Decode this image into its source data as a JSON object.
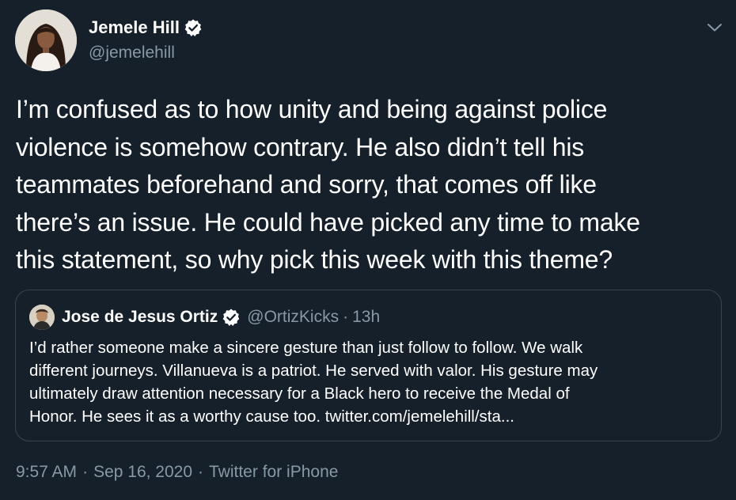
{
  "tweet": {
    "author": {
      "name": "Jemele Hill",
      "handle": "@jemelehill",
      "verified": true
    },
    "text_lines": [
      "I’m confused as to how unity and being against police",
      "violence is somehow contrary. He also didn’t tell his",
      "teammates beforehand and sorry, that comes off like",
      "there’s an issue. He could have picked any time to make",
      "this statement, so why pick this week with this theme?"
    ],
    "quoted": {
      "name": "Jose de Jesus Ortiz",
      "handle": "@OrtizKicks",
      "separator": "·",
      "time": "13h",
      "verified": true,
      "text_lines": [
        "I’d rather someone make a sincere gesture than just follow to follow. We walk",
        "different journeys. Villanueva is a patriot. He served with valor. His gesture may",
        "ultimately draw attention necessary for a Black hero to receive the Medal of",
        "Honor. He sees it as a worthy cause too. twitter.com/jemelehill/sta..."
      ]
    },
    "meta": {
      "time": "9:57 AM",
      "sep1": "·",
      "date": "Sep 16, 2020",
      "sep2": "·",
      "source": "Twitter for iPhone"
    }
  },
  "icons": {
    "verified": "verified-badge-icon",
    "caret": "chevron-down-icon"
  },
  "colors": {
    "background": "#15202b",
    "text_primary": "#ffffff",
    "text_secondary": "#8899a6",
    "border": "#38444d"
  }
}
